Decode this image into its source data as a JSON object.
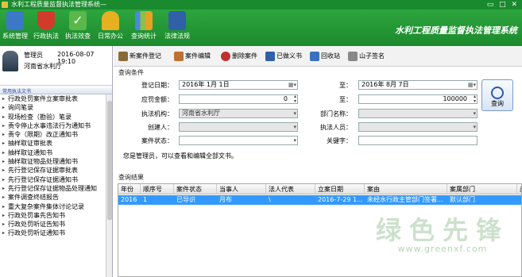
{
  "window": {
    "title": "水利工程质量监督执法管理系统—",
    "controls": "▭ □ ✕"
  },
  "toolbar": {
    "buttons": [
      {
        "label": "系统管理",
        "color": "#3b78c8"
      },
      {
        "label": "行政执法",
        "color": "#d23a2a"
      },
      {
        "label": "执法效查",
        "color": "#5ab84a"
      },
      {
        "label": "日常办公",
        "color": "#e8b020"
      },
      {
        "label": "查询统计",
        "color": "#4a8ad8"
      },
      {
        "label": "法律法规",
        "color": "#3060a8"
      }
    ],
    "app_title": "水利工程质量监督执法管理系统"
  },
  "user": {
    "name": "管理员",
    "datetime": "2016-08-07 19:10",
    "org": "河南省水利厅"
  },
  "nav": {
    "header": "常用执法文书",
    "items": [
      "行政处罚案件立案审批表",
      "询问笔录",
      "现场检查（勘验）笔录",
      "责令停止水事违法行为通知书",
      "责令（限期）改正通知书",
      "抽样取证审批表",
      "抽样取证通知书",
      "抽样取证物品处理通知书",
      "先行登记保存证据审批表",
      "先行登记保存证据通知书",
      "先行登记保存证据物品处理通知",
      "案件调查终结报告",
      "重大复杂案件集体讨论记录",
      "行政处罚事先告知书",
      "行政处罚听证告知书",
      "行政处罚听证通知书"
    ]
  },
  "actions": [
    {
      "label": "新案件登记",
      "color": "#8a6a3a"
    },
    {
      "label": "案件编辑",
      "color": "#c07030"
    },
    {
      "label": "删除案件",
      "color": "#c03030"
    },
    {
      "label": "已做义书",
      "color": "#3060a8"
    },
    {
      "label": "回收站",
      "color": "#3a70c0"
    },
    {
      "label": "山子签名",
      "color": "#888888"
    }
  ],
  "query": {
    "section_label": "查询条件",
    "reg_date_label": "登记日期：",
    "reg_date_from": "2016年 1月 1日",
    "to_label": "至：",
    "reg_date_to": "2016年 8月 7日",
    "amount_label": "应罚金额：",
    "amount_from": "0",
    "amount_to_label": "至：",
    "amount_to": "100000",
    "agency_label": "执法机构：",
    "agency": "河南省水利厅",
    "dept_label": "部门名称：",
    "dept": "",
    "creator_label": "创建人：",
    "creator": "",
    "officer_label": "执法人员：",
    "officer": "",
    "status_label": "案件状态：",
    "status": "",
    "keyword_label": "关键字：",
    "keyword": "",
    "query_button": "查询",
    "tip": "您是管理员，可以查看和编辑全部文书。"
  },
  "results": {
    "section_label": "查询结果",
    "columns": [
      "年份",
      "顺序号",
      "案件状态",
      "当事人",
      "法人代表",
      "立案日期",
      "案由",
      "案属部门",
      "办"
    ],
    "rows": [
      [
        "2016",
        "1",
        "已导识",
        "月布",
        "\\",
        "2016-7-29 1...",
        "未经水行政主管部门签署...",
        "默认部门",
        ""
      ]
    ]
  },
  "watermark": {
    "line1": "绿色先锋",
    "line2": "www.greenxf.com"
  }
}
